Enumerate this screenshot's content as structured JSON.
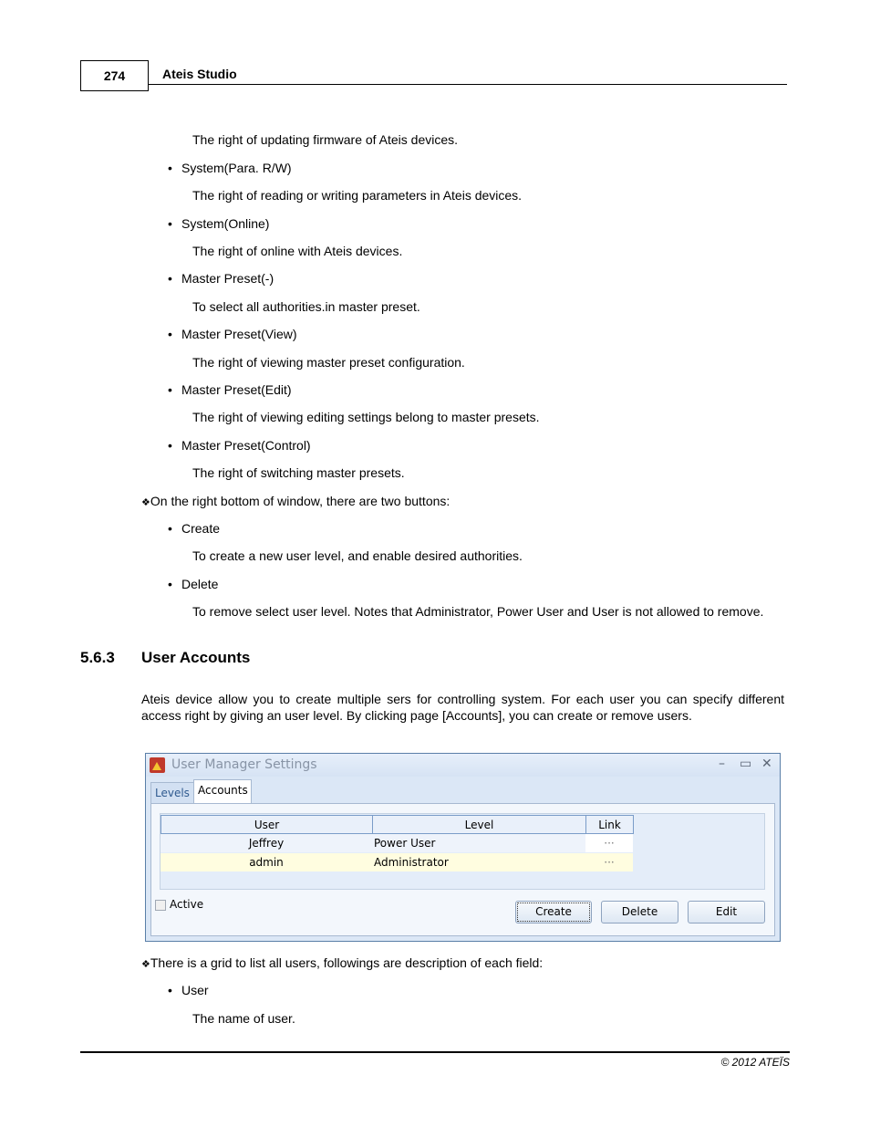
{
  "header": {
    "page_number": "274",
    "title": "Ateis Studio"
  },
  "content": {
    "intro_desc": "The right of updating firmware of Ateis devices.",
    "authorities": [
      {
        "name": "System(Para. R/W)",
        "desc": "The right of reading or writing parameters in Ateis devices."
      },
      {
        "name": "System(Online)",
        "desc": "The right of online with Ateis devices."
      },
      {
        "name": "Master Preset(-)",
        "desc": "To select all authorities.in master preset."
      },
      {
        "name": "Master Preset(View)",
        "desc": "The right of viewing master preset configuration."
      },
      {
        "name": "Master Preset(Edit)",
        "desc": "The right of viewing editing settings belong to master presets."
      },
      {
        "name": "Master Preset(Control)",
        "desc": "The right of switching master presets."
      }
    ],
    "buttons_note": "On the right bottom of window, there are two buttons:",
    "buttons": [
      {
        "name": "Create",
        "desc": "To create a new user level, and enable desired authorities."
      },
      {
        "name": "Delete",
        "desc": "To remove select user level. Notes that Administrator, Power User and User is not allowed to remove."
      }
    ],
    "section": {
      "number": "5.6.3",
      "title": "User Accounts"
    },
    "section_body": "Ateis device allow you to create multiple sers for controlling system. For each user you can specify different access right by giving an user level. By clicking page [Accounts], you can create or remove users.",
    "grid_note": "There is a grid to list all users, followings are description of each field:",
    "fields": [
      {
        "name": "User",
        "desc": "The name of user."
      }
    ]
  },
  "window": {
    "title": "User Manager Settings",
    "controls": {
      "minimize": "–",
      "maximize": "▭",
      "close": "✕"
    },
    "tabs": [
      {
        "label": "Levels",
        "active": false
      },
      {
        "label": "Accounts",
        "active": true
      }
    ],
    "grid": {
      "columns": [
        "User",
        "Level",
        "Link"
      ],
      "rows": [
        {
          "user": "Jeffrey",
          "level": "Power User",
          "link": "···",
          "highlight": false
        },
        {
          "user": "admin",
          "level": "Administrator",
          "link": "···",
          "highlight": true
        }
      ]
    },
    "active_checkbox": {
      "label": "Active",
      "checked": false
    },
    "buttons": {
      "create": "Create",
      "delete": "Delete",
      "edit": "Edit"
    },
    "colors": {
      "row_highlight": "#fffde0",
      "frame": "#5a7fa8"
    }
  },
  "footer": {
    "copyright": "© 2012 ATEÏS"
  },
  "symbols": {
    "bullet": "•",
    "diamond": "❖"
  }
}
